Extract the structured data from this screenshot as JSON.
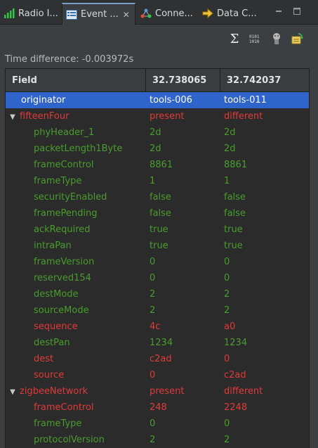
{
  "tabs": [
    {
      "label": "Radio I...",
      "icon": "signal-bars-icon",
      "active": false
    },
    {
      "label": "Event ...",
      "icon": "event-list-icon",
      "active": true
    },
    {
      "label": "Conne...",
      "icon": "connections-icon",
      "active": false
    },
    {
      "label": "Data C...",
      "icon": "data-capture-icon",
      "active": false
    }
  ],
  "time_difference": "Time difference: -0.003972s",
  "table": {
    "headers": [
      "Field",
      "32.738065",
      "32.742037"
    ],
    "rows": [
      {
        "field": "originator",
        "v1": "tools-006",
        "v2": "tools-011",
        "level": 1,
        "color": "selected",
        "selected": true,
        "toggle": ""
      },
      {
        "field": "fifteenFour",
        "v1": "present",
        "v2": "different",
        "level": 0,
        "color": "red",
        "toggle": "▼"
      },
      {
        "field": "phyHeader_1",
        "v1": "2d",
        "v2": "2d",
        "level": 2,
        "color": "green"
      },
      {
        "field": "packetLength1Byte",
        "v1": "2d",
        "v2": "2d",
        "level": 2,
        "color": "green"
      },
      {
        "field": "frameControl",
        "v1": "8861",
        "v2": "8861",
        "level": 2,
        "color": "green"
      },
      {
        "field": "frameType",
        "v1": "1",
        "v2": "1",
        "level": 2,
        "color": "green"
      },
      {
        "field": "securityEnabled",
        "v1": "false",
        "v2": "false",
        "level": 2,
        "color": "green"
      },
      {
        "field": "framePending",
        "v1": "false",
        "v2": "false",
        "level": 2,
        "color": "green"
      },
      {
        "field": "ackRequired",
        "v1": "true",
        "v2": "true",
        "level": 2,
        "color": "green"
      },
      {
        "field": "intraPan",
        "v1": "true",
        "v2": "true",
        "level": 2,
        "color": "green"
      },
      {
        "field": "frameVersion",
        "v1": "0",
        "v2": "0",
        "level": 2,
        "color": "green"
      },
      {
        "field": "reserved154",
        "v1": "0",
        "v2": "0",
        "level": 2,
        "color": "green"
      },
      {
        "field": "destMode",
        "v1": "2",
        "v2": "2",
        "level": 2,
        "color": "green"
      },
      {
        "field": "sourceMode",
        "v1": "2",
        "v2": "2",
        "level": 2,
        "color": "green"
      },
      {
        "field": "sequence",
        "v1": "4c",
        "v2": "a0",
        "level": 2,
        "color": "red"
      },
      {
        "field": "destPan",
        "v1": "1234",
        "v2": "1234",
        "level": 2,
        "color": "green"
      },
      {
        "field": "dest",
        "v1": "c2ad",
        "v2": "0",
        "level": 2,
        "color": "red"
      },
      {
        "field": "source",
        "v1": "0",
        "v2": "c2ad",
        "level": 2,
        "color": "red"
      },
      {
        "field": "zigbeeNetwork",
        "v1": "present",
        "v2": "different",
        "level": 0,
        "color": "red",
        "toggle": "▼"
      },
      {
        "field": "frameControl",
        "v1": "248",
        "v2": "2248",
        "level": 2,
        "color": "red"
      },
      {
        "field": "frameType",
        "v1": "0",
        "v2": "0",
        "level": 2,
        "color": "green"
      },
      {
        "field": "protocolVersion",
        "v1": "2",
        "v2": "2",
        "level": 2,
        "color": "green"
      }
    ]
  },
  "colors": {
    "match": "#4a9c2e",
    "diff": "#e03a3a",
    "selection": "#2f65ca"
  }
}
